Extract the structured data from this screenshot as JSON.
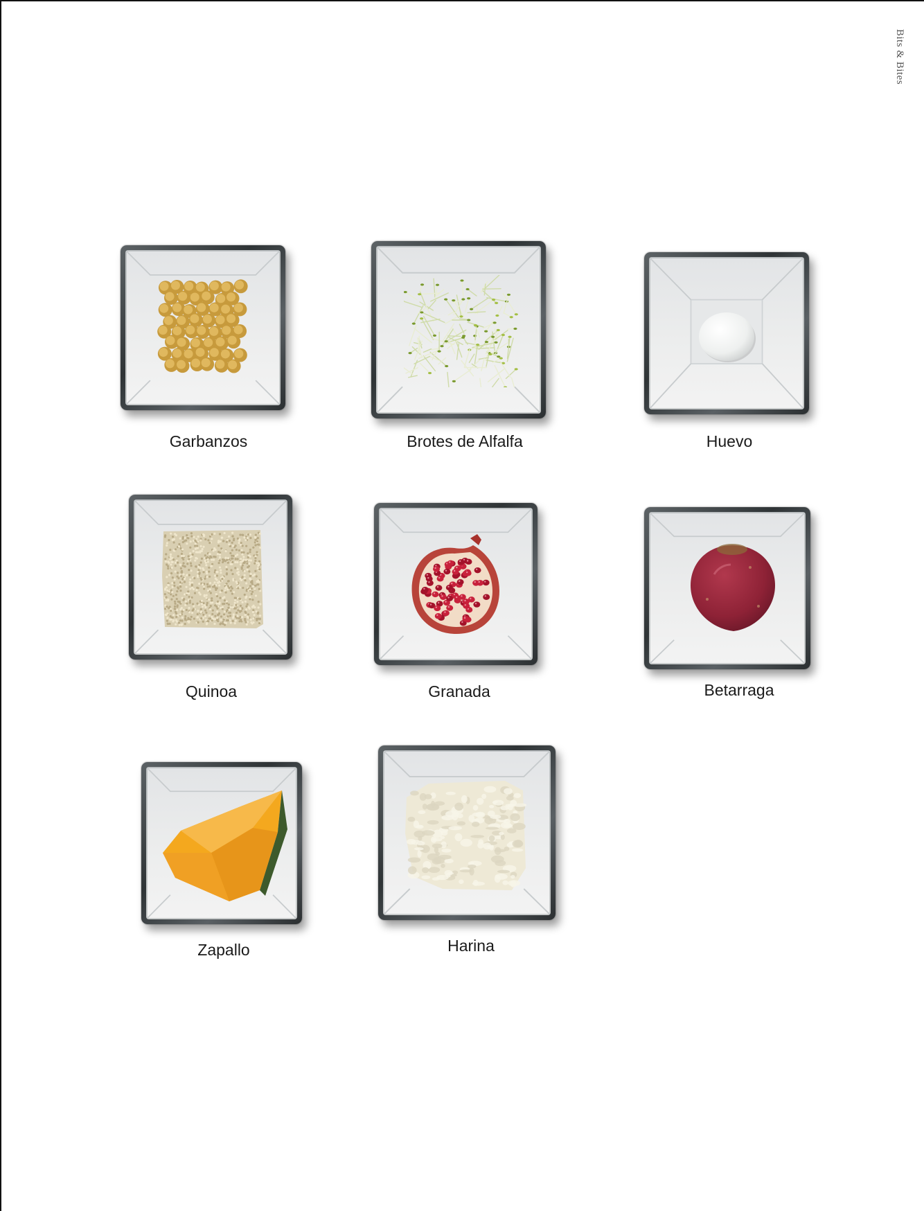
{
  "running_head": "Bits & Bites",
  "items": [
    {
      "label": "Garbanzos",
      "icon": "chickpeas-icon"
    },
    {
      "label": "Brotes de Alfalfa",
      "icon": "alfalfa-sprouts-icon"
    },
    {
      "label": "Huevo",
      "icon": "egg-icon"
    },
    {
      "label": "Quinoa",
      "icon": "quinoa-icon"
    },
    {
      "label": "Granada",
      "icon": "pomegranate-icon"
    },
    {
      "label": "Betarraga",
      "icon": "beetroot-icon"
    },
    {
      "label": "Zapallo",
      "icon": "pumpkin-icon"
    },
    {
      "label": "Harina",
      "icon": "flour-icon"
    }
  ]
}
